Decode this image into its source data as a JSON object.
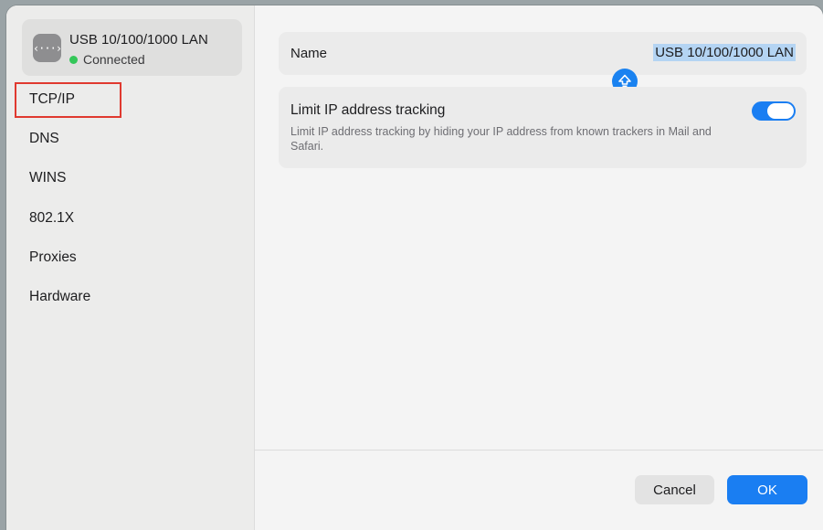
{
  "interface": {
    "name": "USB 10/100/1000 LAN",
    "status": "Connected",
    "icon": "network-interface-icon",
    "status_color": "#34c759"
  },
  "sidebar": {
    "items": [
      {
        "label": "TCP/IP",
        "selected": true
      },
      {
        "label": "DNS"
      },
      {
        "label": "WINS"
      },
      {
        "label": "802.1X"
      },
      {
        "label": "Proxies"
      },
      {
        "label": "Hardware"
      }
    ]
  },
  "form": {
    "name_label": "Name",
    "name_value": "USB 10/100/1000 LAN",
    "limit_title": "Limit IP address tracking",
    "limit_description": "Limit IP address tracking by hiding your IP address from known trackers in Mail and Safari.",
    "limit_enabled": true
  },
  "buttons": {
    "cancel": "Cancel",
    "ok": "OK"
  },
  "colors": {
    "accent": "#1a7ef2",
    "highlight_box": "#e0392f"
  }
}
